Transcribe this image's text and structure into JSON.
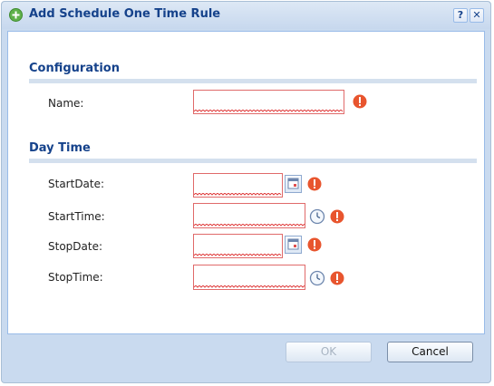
{
  "dialog": {
    "title": "Add Schedule One Time Rule",
    "help_label": "?",
    "close_label": "✕"
  },
  "sections": {
    "configuration": "Configuration",
    "day_time": "Day Time"
  },
  "fields": {
    "name": {
      "label": "Name:",
      "value": ""
    },
    "start_date": {
      "label": "StartDate:",
      "value": ""
    },
    "start_time": {
      "label": "StartTime:",
      "value": ""
    },
    "stop_date": {
      "label": "StopDate:",
      "value": ""
    },
    "stop_time": {
      "label": "StopTime:",
      "value": ""
    }
  },
  "buttons": {
    "ok": "OK",
    "cancel": "Cancel"
  },
  "colors": {
    "accent": "#15428b",
    "error": "#e8552e",
    "invalid_border": "#e06a6a"
  },
  "icons": {
    "title": "add-circle-icon",
    "date_picker": "calendar-icon",
    "time_picker": "clock-icon",
    "error": "error-exclamation-icon"
  }
}
